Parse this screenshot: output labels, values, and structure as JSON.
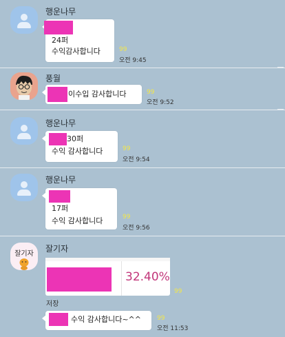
{
  "messages": [
    {
      "sender": "행운나무",
      "lines": [
        "24퍼",
        "수익감사합니다"
      ],
      "unread": "99",
      "time": "오전 9:45"
    },
    {
      "sender": "풍월",
      "text": "이수입 감사합니다",
      "unread": "99",
      "time": "오전 9:52"
    },
    {
      "sender": "행운나무",
      "lines": [
        "30퍼",
        "수익 감사합니다"
      ],
      "unread": "99",
      "time": "오전 9:54"
    },
    {
      "sender": "행운나무",
      "lines": [
        "17퍼",
        "수익 감사합니다"
      ],
      "unread": "99",
      "time": "오전 9:56"
    },
    {
      "sender": "잘기자",
      "avatar_text": "잘기자",
      "percent": "32.40%",
      "caption": "저장",
      "image_unread": "99",
      "text": "수익 감사합니다~^^",
      "unread": "99",
      "time": "오전 11:53"
    }
  ],
  "colors": {
    "background": "#abc1d1",
    "bubble": "#ffffff",
    "redaction": "#ec34b5",
    "unread": "#f3e64a",
    "percent": "#c2367a"
  }
}
